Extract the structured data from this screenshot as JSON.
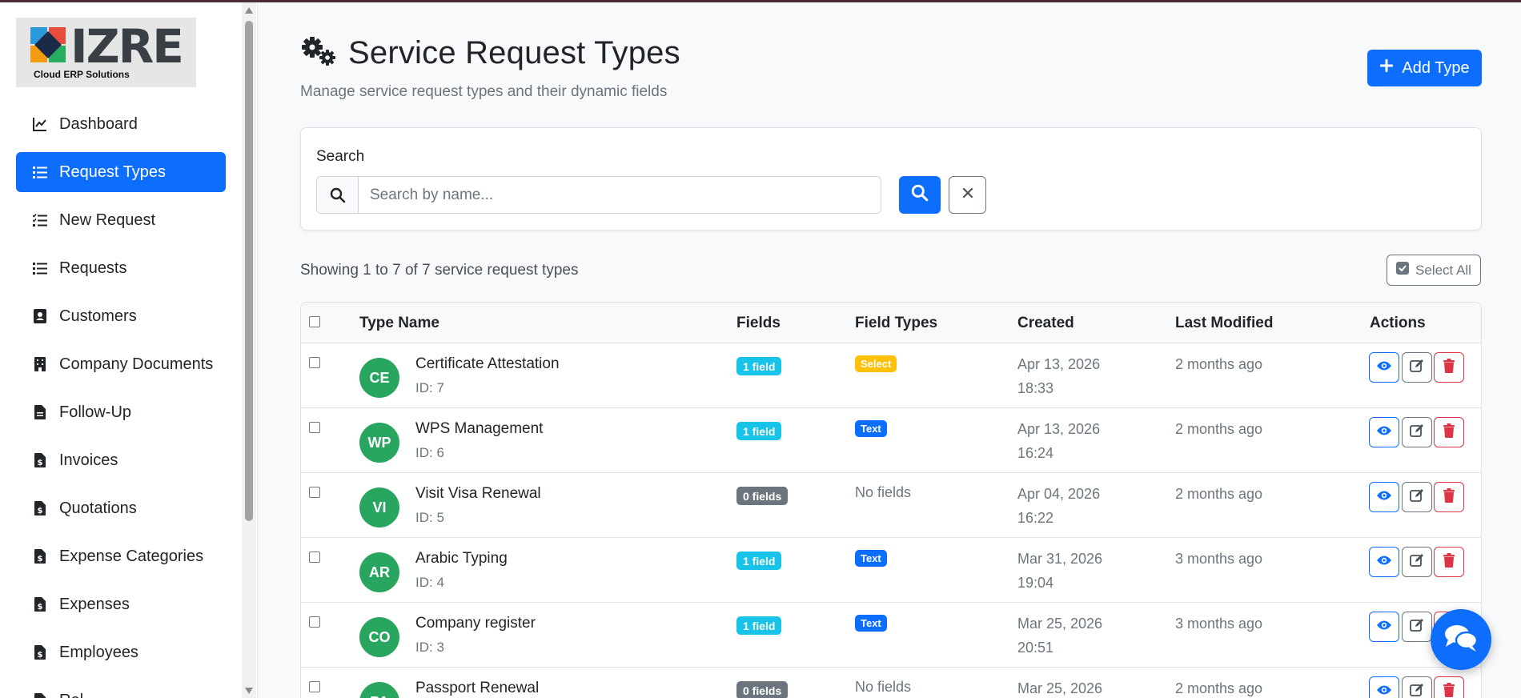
{
  "app": {
    "logo_text": "IZRE",
    "logo_tagline": "Cloud ERP Solutions"
  },
  "sidebar": {
    "items": [
      {
        "label": "Dashboard",
        "icon": "chart-line-icon",
        "active": false
      },
      {
        "label": "Request Types",
        "icon": "list-icon",
        "active": true
      },
      {
        "label": "New Request",
        "icon": "list-check-icon",
        "active": false
      },
      {
        "label": "Requests",
        "icon": "list-icon",
        "active": false
      },
      {
        "label": "Customers",
        "icon": "address-card-icon",
        "active": false
      },
      {
        "label": "Company Documents",
        "icon": "building-icon",
        "active": false
      },
      {
        "label": "Follow-Up",
        "icon": "file-icon",
        "active": false
      },
      {
        "label": "Invoices",
        "icon": "file-invoice-dollar-icon",
        "active": false
      },
      {
        "label": "Quotations",
        "icon": "file-invoice-dollar-icon",
        "active": false
      },
      {
        "label": "Expense Categories",
        "icon": "file-invoice-dollar-icon",
        "active": false
      },
      {
        "label": "Expenses",
        "icon": "file-invoice-dollar-icon",
        "active": false
      },
      {
        "label": "Employees",
        "icon": "file-invoice-dollar-icon",
        "active": false
      },
      {
        "label": "Rol",
        "icon": "file-invoice-dollar-icon",
        "active": false
      }
    ]
  },
  "header": {
    "title": "Service Request Types",
    "subtitle": "Manage service request types and their dynamic fields",
    "add_button": "Add Type"
  },
  "search": {
    "label": "Search",
    "placeholder": "Search by name...",
    "value": ""
  },
  "listing": {
    "summary": "Showing 1 to 7 of 7 service request types",
    "select_all": "Select All"
  },
  "table": {
    "columns": [
      "Type Name",
      "Fields",
      "Field Types",
      "Created",
      "Last Modified",
      "Actions"
    ],
    "rows": [
      {
        "initials": "CE",
        "name": "Certificate Attestation",
        "id": "ID: 7",
        "fields": "1 field",
        "field_type": "Select",
        "field_type_color": "#ffc107",
        "no_fields": "",
        "created_date": "Apr 13, 2026",
        "created_time": "18:33",
        "modified": "2 months ago"
      },
      {
        "initials": "WP",
        "name": "WPS Management",
        "id": "ID: 6",
        "fields": "1 field",
        "field_type": "Text",
        "field_type_color": "#0d6efd",
        "no_fields": "",
        "created_date": "Apr 13, 2026",
        "created_time": "16:24",
        "modified": "2 months ago"
      },
      {
        "initials": "VI",
        "name": "Visit Visa Renewal",
        "id": "ID: 5",
        "fields": "0 fields",
        "field_type": "",
        "field_type_color": "",
        "no_fields": "No fields",
        "created_date": "Apr 04, 2026",
        "created_time": "16:22",
        "modified": "2 months ago"
      },
      {
        "initials": "AR",
        "name": "Arabic Typing",
        "id": "ID: 4",
        "fields": "1 field",
        "field_type": "Text",
        "field_type_color": "#0d6efd",
        "no_fields": "",
        "created_date": "Mar 31, 2026",
        "created_time": "19:04",
        "modified": "3 months ago"
      },
      {
        "initials": "CO",
        "name": "Company register",
        "id": "ID: 3",
        "fields": "1 field",
        "field_type": "Text",
        "field_type_color": "#0d6efd",
        "no_fields": "",
        "created_date": "Mar 25, 2026",
        "created_time": "20:51",
        "modified": "3 months ago"
      },
      {
        "initials": "PA",
        "name": "Passport Renewal",
        "id": "",
        "fields": "0 fields",
        "field_type": "",
        "field_type_color": "",
        "no_fields": "No fields",
        "created_date": "Mar 25, 2026",
        "created_time": "",
        "modified": "2 months ago"
      }
    ]
  },
  "colors": {
    "primary": "#0d6efd",
    "avatar": "#28a55f",
    "badge_info": "#17c3e8",
    "badge_secondary": "#6c757d",
    "badge_warning": "#ffc107",
    "danger": "#dc3545"
  }
}
